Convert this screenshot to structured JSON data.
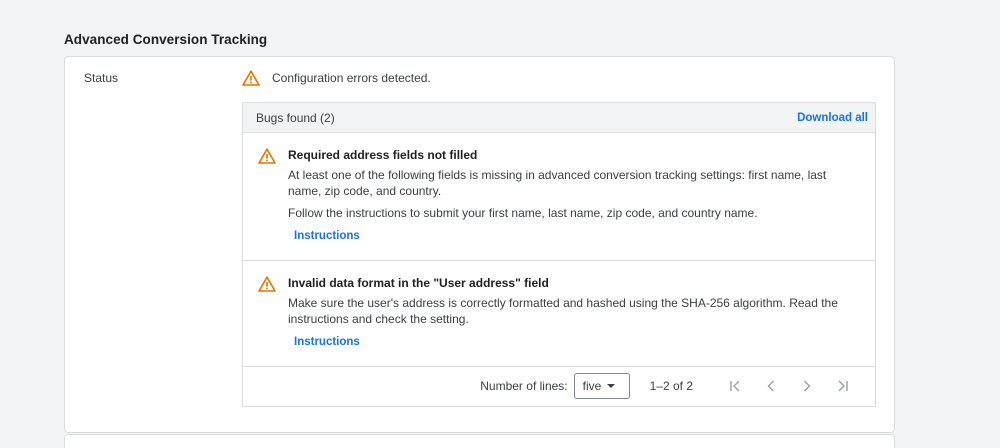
{
  "section": {
    "title": "Advanced Conversion Tracking"
  },
  "status": {
    "label": "Status",
    "message": "Configuration errors detected."
  },
  "bugs": {
    "header": "Bugs found (2)",
    "download_label": "Download all",
    "items": [
      {
        "title": "Required address fields not filled",
        "text1": "At least one of the following fields is missing in advanced conversion tracking settings: first name, last name, zip code, and country.",
        "text2": "Follow the instructions to submit your first name, last name, zip code, and country name.",
        "link": "Instructions"
      },
      {
        "title": "Invalid data format in the \"User address\" field",
        "text1": "Make sure the user's address is correctly formatted and hashed using the SHA-256 algorithm. Read the instructions and check the setting.",
        "link": "Instructions"
      }
    ]
  },
  "pager": {
    "lines_label": "Number of lines:",
    "lines_value": "five",
    "range": "1–2 of 2"
  },
  "colors": {
    "warning": "#e37400",
    "link": "#1a73e8",
    "nav_disabled": "#9aa0a6"
  }
}
